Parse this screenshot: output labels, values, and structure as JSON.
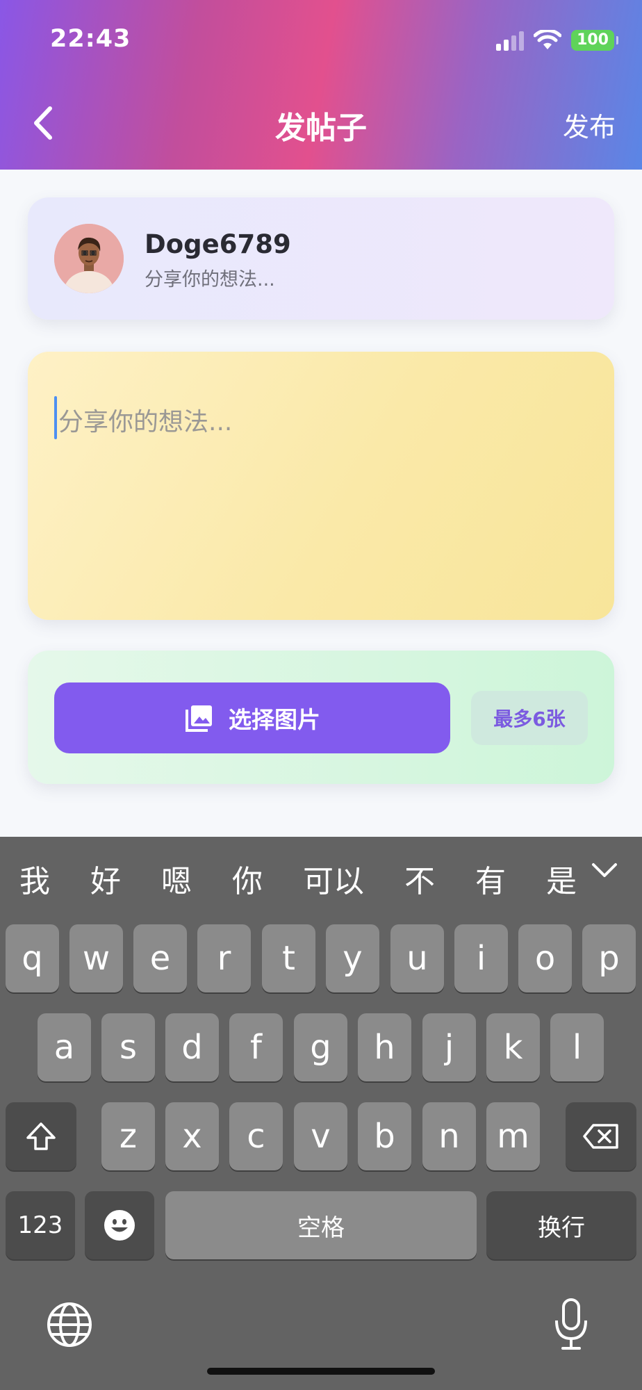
{
  "status_bar": {
    "time": "22:43",
    "battery": "100"
  },
  "nav": {
    "title": "发帖子",
    "publish": "发布"
  },
  "user": {
    "name": "Doge6789",
    "subtitle": "分享你的想法..."
  },
  "post": {
    "placeholder": "分享你的想法..."
  },
  "image_picker": {
    "button_label": "选择图片",
    "limit": "最多6张"
  },
  "keyboard": {
    "candidates": [
      "我",
      "好",
      "嗯",
      "你",
      "可以",
      "不",
      "有",
      "是"
    ],
    "row1": [
      "q",
      "w",
      "e",
      "r",
      "t",
      "y",
      "u",
      "i",
      "o",
      "p"
    ],
    "row2": [
      "a",
      "s",
      "d",
      "f",
      "g",
      "h",
      "j",
      "k",
      "l"
    ],
    "row3": [
      "z",
      "x",
      "c",
      "v",
      "b",
      "n",
      "m"
    ],
    "numbers": "123",
    "space": "空格",
    "return": "换行"
  },
  "colors": {
    "accent": "#825bee",
    "user_card": "#ebe8fb",
    "text_card": "#fbeaa8",
    "image_card": "#d8f6e2",
    "keyboard_bg": "#636363"
  }
}
